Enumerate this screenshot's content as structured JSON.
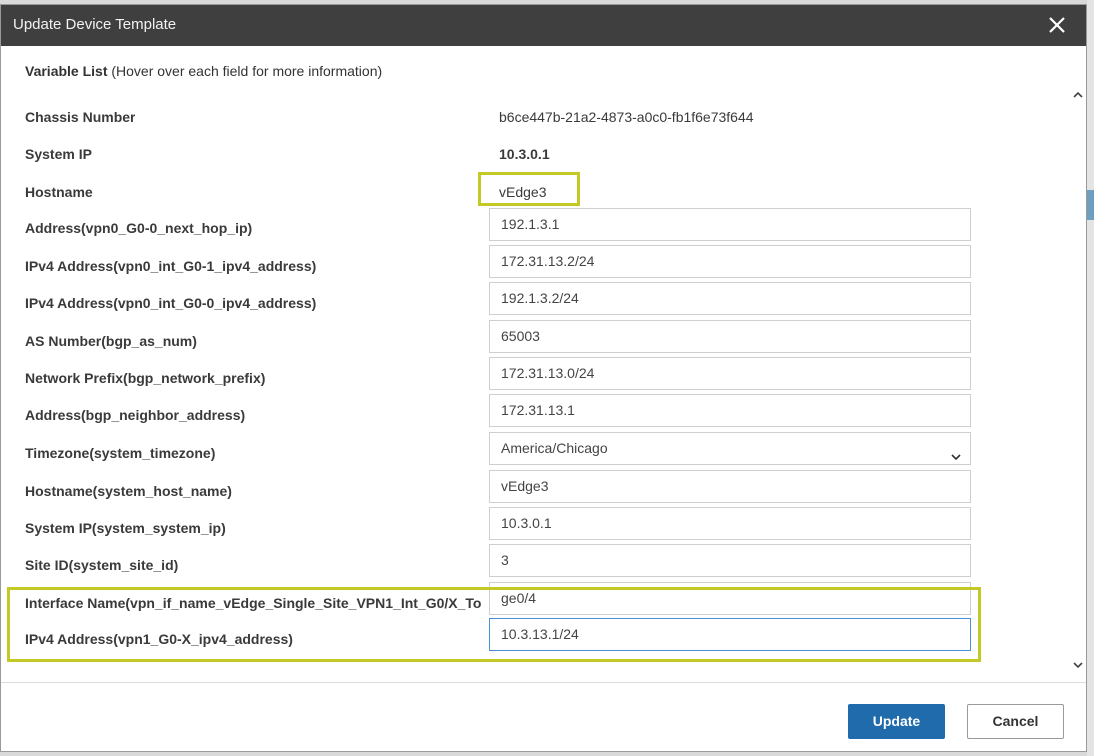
{
  "dialog": {
    "title": "Update Device Template",
    "heading_bold": "Variable List",
    "heading_note": "(Hover over each field for more information)"
  },
  "static_rows": [
    {
      "label": "Chassis Number",
      "value": "b6ce447b-21a2-4873-a0c0-fb1f6e73f644"
    },
    {
      "label": "System IP",
      "value": "10.3.0.1"
    },
    {
      "label": "Hostname",
      "value": "vEdge3"
    }
  ],
  "fields": [
    {
      "label": "Address(vpn0_G0-0_next_hop_ip)",
      "value": "192.1.3.1"
    },
    {
      "label": "IPv4 Address(vpn0_int_G0-1_ipv4_address)",
      "value": "172.31.13.2/24"
    },
    {
      "label": "IPv4 Address(vpn0_int_G0-0_ipv4_address)",
      "value": "192.1.3.2/24"
    },
    {
      "label": "AS Number(bgp_as_num)",
      "value": "65003"
    },
    {
      "label": "Network Prefix(bgp_network_prefix)",
      "value": "172.31.13.0/24"
    },
    {
      "label": "Address(bgp_neighbor_address)",
      "value": "172.31.13.1"
    },
    {
      "label": "Timezone(system_timezone)",
      "value": "America/Chicago"
    },
    {
      "label": "Hostname(system_host_name)",
      "value": "vEdge3"
    },
    {
      "label": "System IP(system_system_ip)",
      "value": "10.3.0.1"
    },
    {
      "label": "Site ID(system_site_id)",
      "value": "3"
    },
    {
      "label": "Interface Name(vpn_if_name_vEdge_Single_Site_VPN1_Int_G0/X_To",
      "value": "ge0/4"
    },
    {
      "label": "IPv4 Address(vpn1_G0-X_ipv4_address)",
      "value": "10.3.13.1/24"
    }
  ],
  "buttons": {
    "update": "Update",
    "cancel": "Cancel"
  },
  "colors": {
    "titlebar": "#3f3f3f",
    "primary": "#1f6bab",
    "highlight": "#c3c925",
    "focus": "#4a90d9"
  },
  "icons": {
    "close": "close-icon",
    "scroll_up": "chevron-up-icon",
    "scroll_down": "chevron-down-icon",
    "dropdown": "chevron-down-icon"
  }
}
